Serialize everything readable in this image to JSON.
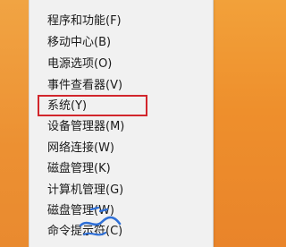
{
  "menu": {
    "items": [
      {
        "label": "程序和功能(F)"
      },
      {
        "label": "移动中心(B)"
      },
      {
        "label": "电源选项(O)"
      },
      {
        "label": "事件查看器(V)"
      },
      {
        "label": "系统(Y)"
      },
      {
        "label": "设备管理器(M)"
      },
      {
        "label": "网络连接(W)"
      },
      {
        "label": "磁盘管理(K)"
      },
      {
        "label": "计算机管理(G)"
      },
      {
        "label": "磁盘管理(W)"
      },
      {
        "label": "命令提示符(C)"
      }
    ]
  },
  "colors": {
    "highlight": "#d2262c",
    "annotation": "#2f6fd6",
    "menu_bg": "#f1f1f1",
    "desktop_bg": "#ee8f2c"
  }
}
